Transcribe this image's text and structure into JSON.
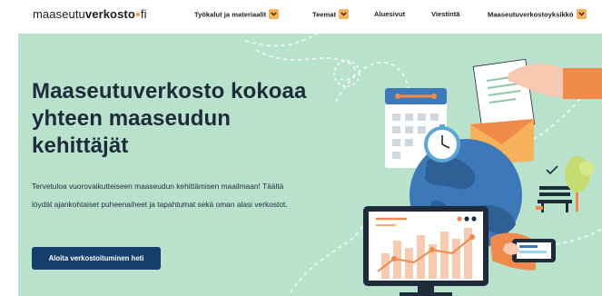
{
  "header": {
    "logo": {
      "prefix": "maaseutu",
      "bold": "verkosto",
      "suffix": "fi"
    },
    "nav": [
      {
        "label": "Työkalut ja materiaalit",
        "dropdown": true
      },
      {
        "label": "Teemat",
        "dropdown": true
      },
      {
        "label": "Aluesivut",
        "dropdown": false
      },
      {
        "label": "Viestintä",
        "dropdown": false
      },
      {
        "label": "Maaseutuverkostoyksikkö",
        "dropdown": true
      }
    ]
  },
  "hero": {
    "title": "Maaseutuverkosto kokoaa yhteen maaseudun kehittäjät",
    "text": "Tervetuloa vuorovaikutteiseen maaseudun kehittämisen maailmaan! Täältä löydät ajankohtaiset puheenaiheet ja tapahtumat sekä oman alasi verkostot.",
    "cta_label": "Aloita verkostoituminen heti"
  },
  "colors": {
    "hero_bg": "#b9e2cd",
    "button": "#163d6b",
    "accent": "#f6b15a",
    "illustration_orange": "#f08a4b",
    "globe_blue": "#3d79b8"
  },
  "icons": [
    "chevron-down-icon",
    "calendar-icon",
    "clock-icon",
    "envelope-icon",
    "globe-icon",
    "monitor-chart-icon",
    "phone-in-hand-icon",
    "bench-icon",
    "tree-icon",
    "checkmark-icon"
  ]
}
